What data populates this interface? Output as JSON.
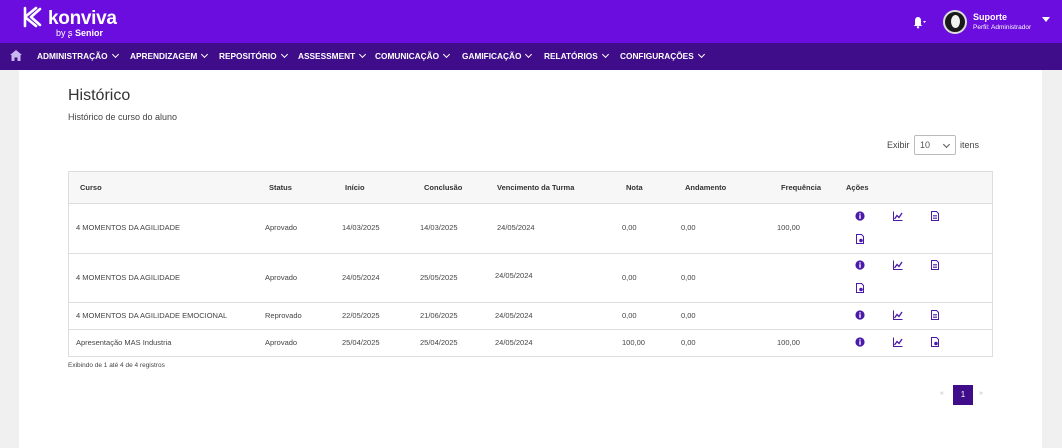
{
  "brand": {
    "name": "konviva",
    "sub_by": "by",
    "sub_brand": "Senior"
  },
  "user": {
    "name": "Suporte",
    "role": "Perfil: Administrador"
  },
  "nav": {
    "items": [
      {
        "label": "ADMINISTRAÇÃO"
      },
      {
        "label": "APRENDIZAGEM"
      },
      {
        "label": "REPOSITÓRIO"
      },
      {
        "label": "ASSESSMENT"
      },
      {
        "label": "COMUNICAÇÃO"
      },
      {
        "label": "GAMIFICAÇÃO"
      },
      {
        "label": "RELATÓRIOS"
      },
      {
        "label": "CONFIGURAÇÕES"
      }
    ]
  },
  "page": {
    "title": "Histórico",
    "subtitle": "Histórico de curso do aluno"
  },
  "page_size": {
    "label_before": "Exibir",
    "value": "10",
    "label_after": "itens"
  },
  "table": {
    "headers": [
      "Curso",
      "Status",
      "Início",
      "Conclusão",
      "Vencimento da Turma",
      "Nota",
      "Andamento",
      "Frequência",
      "Ações"
    ],
    "rows": [
      {
        "curso": "4 MOMENTOS DA AGILIDADE",
        "status": "Aprovado",
        "inicio": "14/03/2025",
        "conclusao": "14/03/2025",
        "vencimento": "24/05/2024",
        "nota": "0,00",
        "andamento": "0,00",
        "frequencia": "100,00"
      },
      {
        "curso": "4 MOMENTOS DA AGILIDADE",
        "status": "Aprovado",
        "inicio": "24/05/2024",
        "conclusao": "25/05/2025",
        "vencimento": "24/05/2024",
        "nota": "0,00",
        "andamento": "0,00",
        "frequencia": ""
      },
      {
        "curso": "4 MOMENTOS DA AGILIDADE EMOCIONAL",
        "status": "Reprovado",
        "inicio": "22/05/2025",
        "conclusao": "21/06/2025",
        "vencimento": "24/05/2024",
        "nota": "0,00",
        "andamento": "0,00",
        "frequencia": ""
      },
      {
        "curso": "Apresentação MAS Industria",
        "status": "Aprovado",
        "inicio": "25/04/2025",
        "conclusao": "25/04/2025",
        "vencimento": "24/05/2024",
        "nota": "100,00",
        "andamento": "0,00",
        "frequencia": "100,00"
      }
    ]
  },
  "footer": {
    "info": "Exibindo de 1 até 4 de 4 registros"
  },
  "pagination": {
    "prev": "«",
    "current": "1",
    "next": "»"
  },
  "colors": {
    "topbar": "#6a0dde",
    "navbar": "#3f0d8a",
    "icon": "#4a1aa8"
  }
}
